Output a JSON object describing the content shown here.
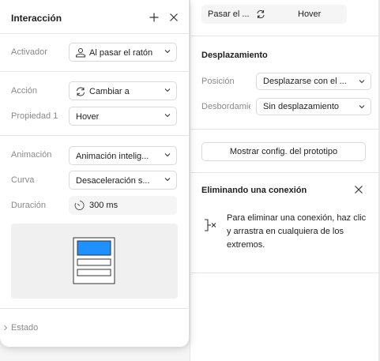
{
  "right_panel": {
    "state_selector": {
      "trigger_label": "Pasar el ...",
      "state_value": "Hover"
    },
    "scroll_section": {
      "title": "Desplazamiento",
      "position_label": "Posición",
      "position_value": "Desplazarse con el ...",
      "overflow_label": "Desbordamiento",
      "overflow_value": "Sin desplazamiento"
    },
    "prototype_button": "Mostrar config. del prototipo",
    "hint": {
      "title": "Eliminando una conexión",
      "text": "Para eliminar una conexión, haz clic y arrastra en cualquiera de los extremos."
    }
  },
  "popover": {
    "title": "Interacción",
    "trigger": {
      "label": "Activador",
      "value": "Al pasar el ratón"
    },
    "action": {
      "label": "Acción",
      "value": "Cambiar a"
    },
    "property": {
      "label": "Propiedad 1",
      "value": "Hover"
    },
    "animation": {
      "label": "Animación",
      "value": "Animación intelig..."
    },
    "curve": {
      "label": "Curva",
      "value": "Desaceleración s..."
    },
    "duration": {
      "label": "Duración",
      "value": "300 ms"
    },
    "state_footer": "Estado"
  },
  "colors": {
    "accent_blue": "#1e90ff",
    "border": "#d9d9d9",
    "muted_text": "#8a8a8a"
  }
}
